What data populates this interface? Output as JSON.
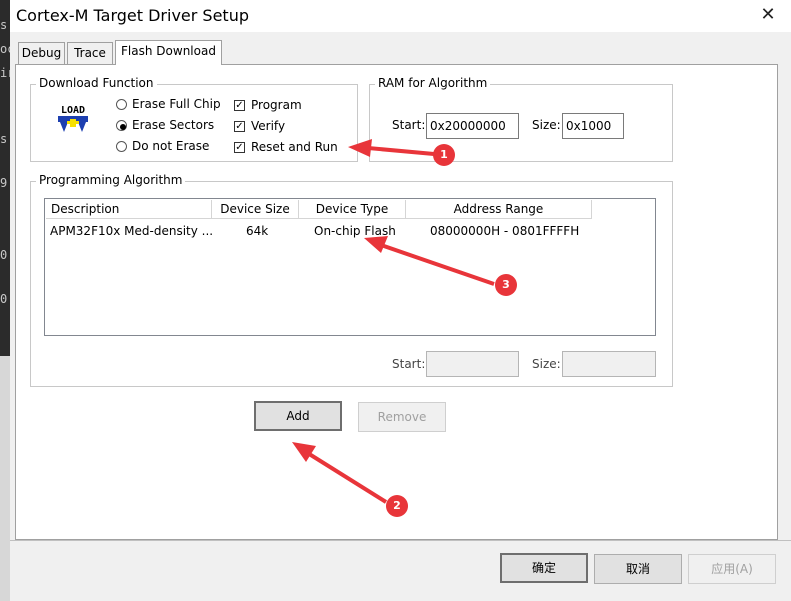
{
  "window": {
    "title": "Cortex-M Target Driver Setup",
    "close_glyph": "✕"
  },
  "background_edge": {
    "glyphs": [
      "s",
      "oc",
      "ir",
      "s",
      "9",
      "0",
      "0"
    ]
  },
  "tabs": [
    {
      "label": "Debug",
      "active": false
    },
    {
      "label": "Trace",
      "active": false
    },
    {
      "label": "Flash Download",
      "active": true
    }
  ],
  "download_function": {
    "title": "Download Function",
    "load_icon_text": "LOAD",
    "radios": [
      {
        "label": "Erase Full Chip",
        "selected": false
      },
      {
        "label": "Erase Sectors",
        "selected": true
      },
      {
        "label": "Do not Erase",
        "selected": false
      }
    ],
    "checks": [
      {
        "label": "Program",
        "checked": true
      },
      {
        "label": "Verify",
        "checked": true
      },
      {
        "label": "Reset and Run",
        "checked": true
      }
    ],
    "check_glyph": "✓"
  },
  "ram": {
    "title": "RAM for Algorithm",
    "start_label": "Start:",
    "start_value": "0x20000000",
    "size_label": "Size:",
    "size_value": "0x1000"
  },
  "algorithm": {
    "title": "Programming Algorithm",
    "columns": [
      "Description",
      "Device Size",
      "Device Type",
      "Address Range"
    ],
    "rows": [
      {
        "description": "APM32F10x Med-density ...",
        "size": "64k",
        "type": "On-chip Flash",
        "range": "08000000H - 0801FFFFH"
      }
    ],
    "start_label": "Start:",
    "start_value": "",
    "size_label": "Size:",
    "size_value": ""
  },
  "buttons": {
    "add": "Add",
    "remove": "Remove",
    "ok": "确定",
    "cancel": "取消",
    "apply": "应用(A)"
  },
  "annotations": {
    "color": "#e8353a",
    "badges": [
      "1",
      "2",
      "3"
    ]
  }
}
